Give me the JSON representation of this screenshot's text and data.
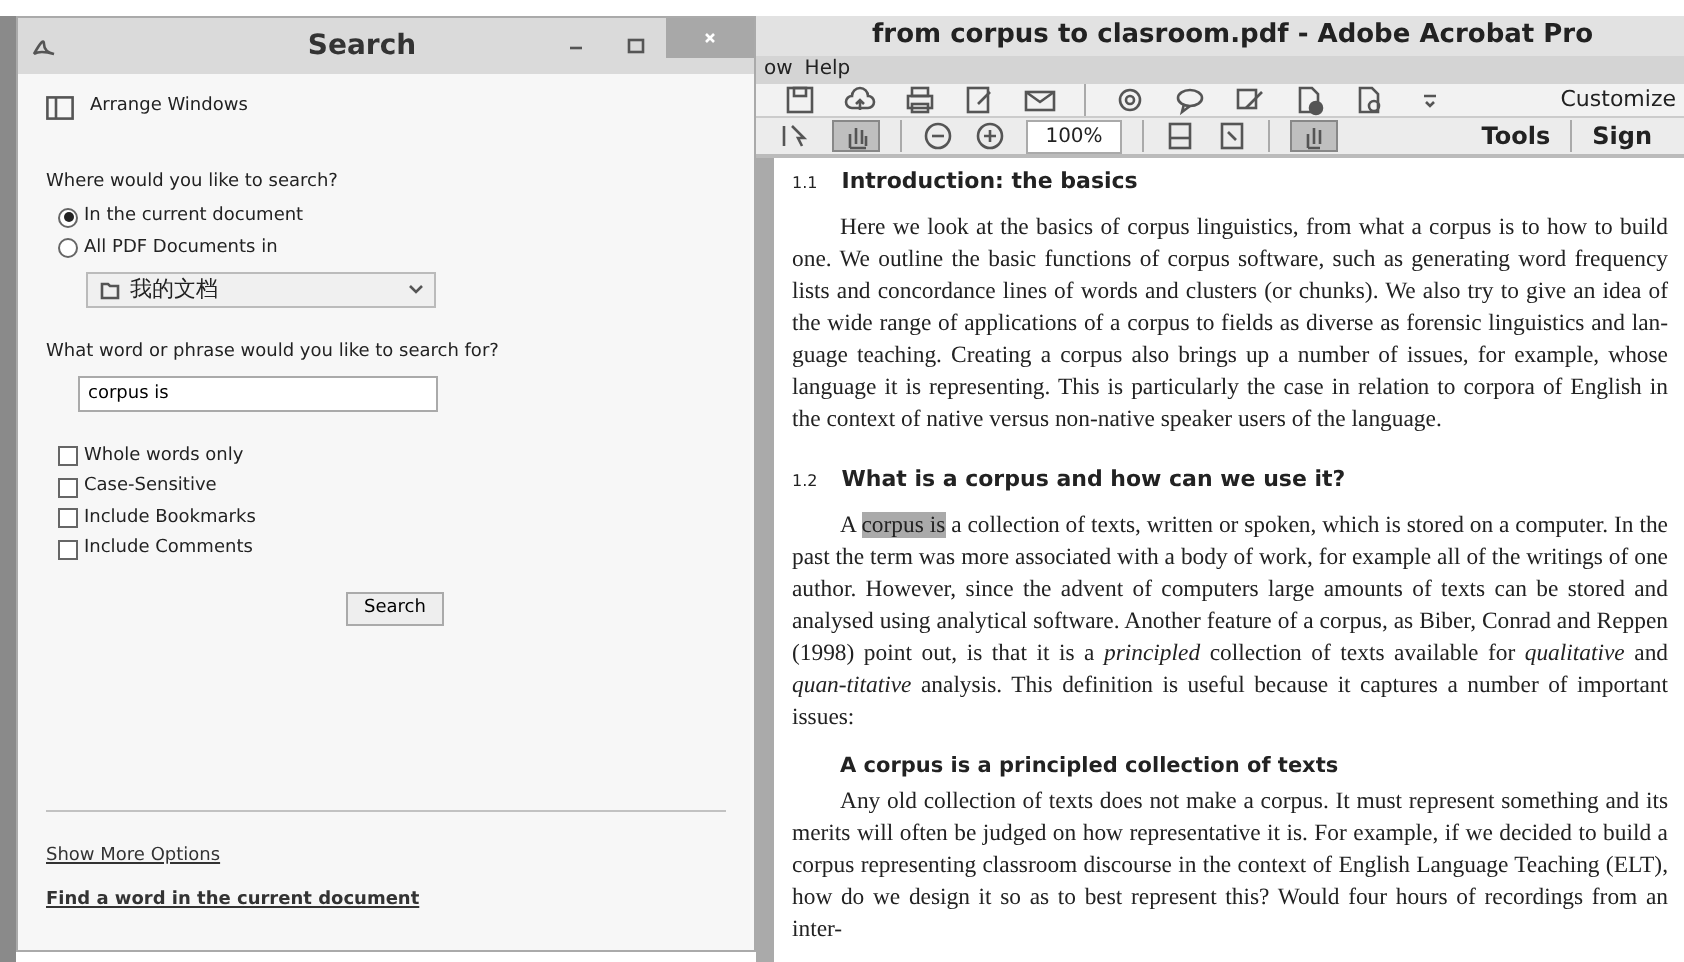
{
  "search_window": {
    "title": "Search",
    "arrange_windows": "Arrange Windows",
    "where_label": "Where would you like to search?",
    "scope_options": [
      {
        "label": "In the current document",
        "selected": true
      },
      {
        "label": "All PDF Documents in",
        "selected": false
      }
    ],
    "folder": "我的文档",
    "phrase_label": "What word or phrase would you like to search for?",
    "phrase_value": "corpus is",
    "options": [
      {
        "label": "Whole words only",
        "checked": false
      },
      {
        "label": "Case-Sensitive",
        "checked": false
      },
      {
        "label": "Include Bookmarks",
        "checked": false
      },
      {
        "label": "Include Comments",
        "checked": false
      }
    ],
    "search_button": "Search",
    "links": [
      {
        "label": "Show More Options",
        "bold": false
      },
      {
        "label": "Find a word in the current document",
        "bold": true
      }
    ]
  },
  "acrobat": {
    "title": "from corpus to clasroom.pdf - Adobe Acrobat Pro",
    "menu": [
      "ow",
      "Help"
    ],
    "customize": "Customize",
    "zoom": "100%",
    "hand_tool_selected": true,
    "tools": "Tools",
    "sign": "Sign",
    "document": [
      {
        "kind": "heading",
        "number": "1.1",
        "text": "Introduction: the basics"
      },
      {
        "kind": "paragraph",
        "text": "Here we look at the basics of corpus linguistics, from what a corpus is to how to build one. We outline the basic functions of corpus software, such as generating word frequency lists and concordance lines of words and clusters (or chunks). We also try to give an idea of the wide range of applications of a corpus to fields as diverse as forensic linguistics and lan-guage teaching. Creating a corpus also brings up a number of issues, for example, whose language it is representing. This is particularly the case in relation to corpora of English in the context of native versus non-native speaker users of the language."
      },
      {
        "kind": "heading",
        "number": "1.2",
        "text": "What is a corpus and how can we use it?"
      },
      {
        "kind": "paragraph",
        "before": "A ",
        "highlight": "corpus is",
        "text": " a collection of texts, written or spoken, which is stored on a computer. In the past the term was more associated with a body of work, for example all of the writings of one author. However, since the advent of computers large amounts of texts can be stored and analysed using analytical software. Another feature of a corpus, as Biber, Conrad and Reppen (1998) point out, is that it is a *principled* collection of texts available for *qualitative* and *quan-titative* analysis. This definition is useful because it captures a number of important issues:"
      },
      {
        "kind": "subheading",
        "text": "A corpus is a principled collection of texts"
      },
      {
        "kind": "paragraph",
        "text": "Any old collection of texts does not make a corpus. It must represent something and its merits will often be judged on how representative it is. For example, if we decided to build a corpus representing classroom discourse in the context of English Language Teaching (ELT), how do we design it so as to best represent this? Would four hours of recordings from an inter-"
      }
    ]
  }
}
